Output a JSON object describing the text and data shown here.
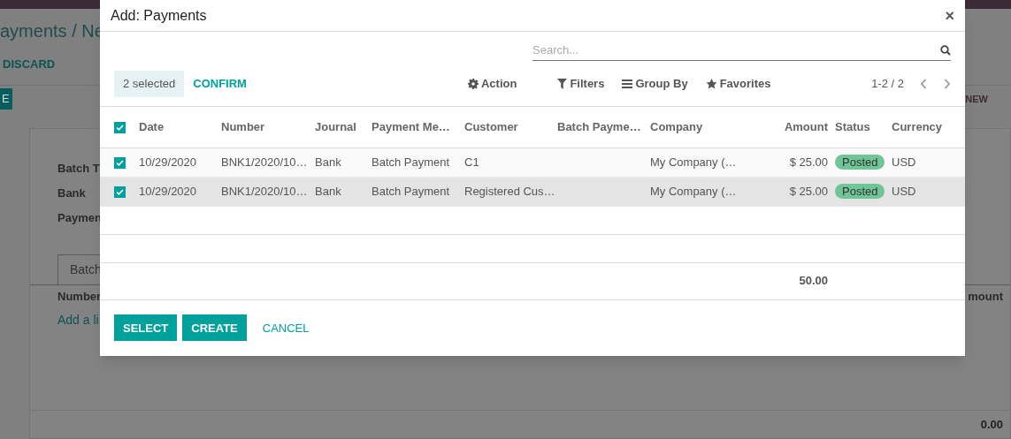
{
  "background": {
    "breadcrumb": "ayments / Ne",
    "discard": "DISCARD",
    "primary_button": "E",
    "status": "NEW",
    "fields": [
      "Batch T",
      "Bank",
      "Paymen"
    ],
    "tab": "Batch",
    "list_column": "Number",
    "add_line": "Add a li",
    "amount_column": "mount",
    "total": "0.00"
  },
  "dialog": {
    "title": "Add: Payments",
    "close": "×",
    "search": {
      "placeholder": "Search..."
    },
    "selection": "2 selected",
    "confirm": "CONFIRM",
    "toolbar": [
      {
        "label": "Action",
        "kind": "action"
      },
      {
        "label": "Filters",
        "kind": "filter"
      },
      {
        "label": "Group By",
        "kind": "group"
      },
      {
        "label": "Favorites",
        "kind": "favorite"
      }
    ],
    "pager": "1-2 / 2",
    "table": {
      "all_checked": true,
      "columns": [
        "Date",
        "Number",
        "Journal",
        "Payment Me…",
        "Customer",
        "Batch Payme…",
        "Company",
        "Amount",
        "Status",
        "Currency"
      ],
      "rows": [
        {
          "checked": true,
          "highlighted": false,
          "date": "10/29/2020",
          "number": "BNK1/2020/10…",
          "journal": "Bank",
          "payment_method": "Batch Payment",
          "customer": "C1",
          "company": "My Company (…",
          "amount": "$ 25.00",
          "status": "Posted",
          "currency": "USD"
        },
        {
          "checked": true,
          "highlighted": true,
          "date": "10/29/2020",
          "number": "BNK1/2020/10…",
          "journal": "Bank",
          "payment_method": "Batch Payment",
          "customer": "Registered Cus…",
          "company": "My Company (…",
          "amount": "$ 25.00",
          "status": "Posted",
          "currency": "USD"
        }
      ],
      "total": "50.00"
    },
    "buttons": [
      {
        "label": "SELECT",
        "kind": "primary"
      },
      {
        "label": "CREATE",
        "kind": "primary"
      },
      {
        "label": "CANCEL",
        "kind": "link"
      }
    ]
  }
}
